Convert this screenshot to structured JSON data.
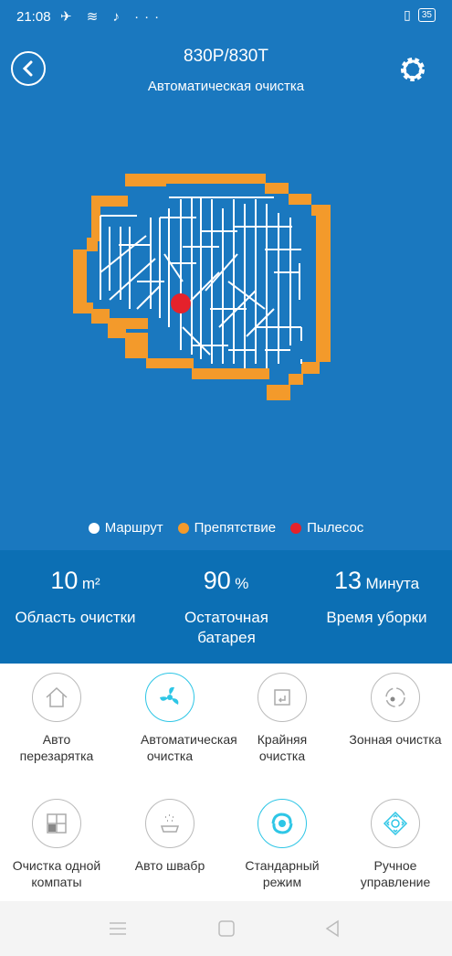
{
  "status_bar": {
    "time": "21:08",
    "battery": "35"
  },
  "header": {
    "title": "830P/830T",
    "subtitle": "Автоматическая очистка"
  },
  "legend": [
    {
      "label": "Маршрут",
      "color": "#ffffff"
    },
    {
      "label": "Препятствие",
      "color": "#f39a2b"
    },
    {
      "label": "Пылесос",
      "color": "#e5222b"
    }
  ],
  "stats": [
    {
      "value": "10",
      "unit": "m²",
      "label": "Область очистки"
    },
    {
      "value": "90",
      "unit": "%",
      "label": "Остаточная батарея"
    },
    {
      "value": "13",
      "unit": "Минута",
      "label": "Время уборки"
    }
  ],
  "modes": [
    {
      "label": "Авто перезарятка",
      "icon": "home-icon",
      "active": false
    },
    {
      "label": "Автоматическая очистка",
      "icon": "fan-icon",
      "active": true
    },
    {
      "label": "Крайняя очистка",
      "icon": "edge-icon",
      "active": false
    },
    {
      "label": "Зонная очистка",
      "icon": "spot-icon",
      "active": false
    },
    {
      "label": "Очистка одной компаты",
      "icon": "room-icon",
      "active": false
    },
    {
      "label": "Авто швабр",
      "icon": "mop-icon",
      "active": false
    },
    {
      "label": "Стандарный режим",
      "icon": "swirl-icon",
      "active": true
    },
    {
      "label": "Ручное управление",
      "icon": "dpad-icon",
      "active": false
    }
  ],
  "colors": {
    "accent": "#1a78bf",
    "obstacle": "#f39a2b",
    "vacuum": "#e5222b",
    "active": "#2ec6e6"
  }
}
